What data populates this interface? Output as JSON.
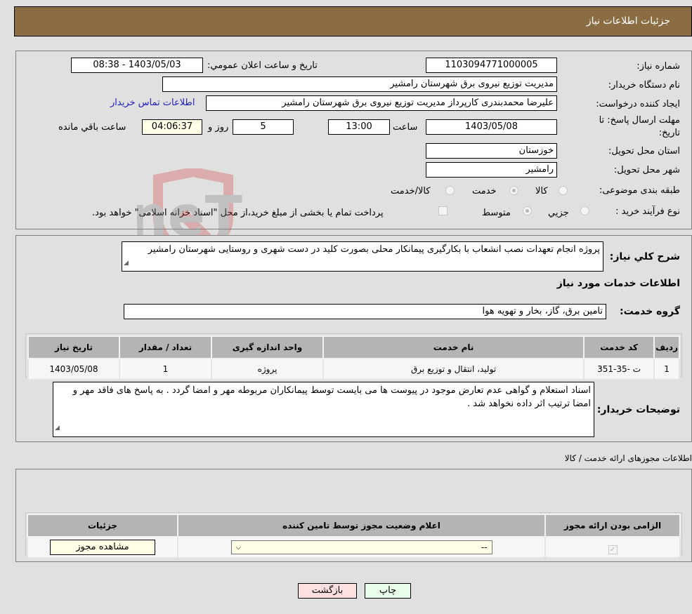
{
  "header": {
    "title": "جزئیات اطلاعات نیاز"
  },
  "details": {
    "need_number_label": "شماره نیاز:",
    "need_number": "1103094771000005",
    "announce_label": "تاریخ و ساعت اعلان عمومي:",
    "announce_value": "1403/05/03 - 08:38",
    "buyer_org_label": "نام دستگاه خریدار:",
    "buyer_org": "مدیریت توزیع نیروی برق شهرستان رامشیر",
    "creator_label": "ایجاد کننده درخواست:",
    "creator": "علیرضا محمدبندری کارپرداز مدیریت توزیع نیروی برق شهرستان رامشیر",
    "contact_link": "اطلاعات تماس خریدار",
    "deadline_label_1": "مهلت ارسال پاسخ: تا",
    "deadline_label_2": "تاریخ:",
    "deadline_date": "1403/05/08",
    "time_label": "ساعت",
    "deadline_time": "13:00",
    "days_value": "5",
    "days_label": "روز و",
    "remaining_time": "04:06:37",
    "remaining_label": "ساعت باقي مانده",
    "province_label": "استان محل تحویل:",
    "province": "خوزستان",
    "city_label": "شهر محل تحویل:",
    "city": "رامشیر",
    "category_label": "طبقه بندی موضوعی:",
    "category_options": [
      "کالا",
      "خدمت",
      "کالا/خدمت"
    ],
    "category_selected": "خدمت",
    "process_label": "نوع فرآیند خرید :",
    "process_options": [
      "جزيي",
      "متوسط"
    ],
    "process_selected": "متوسط",
    "treasury_note": "پرداخت تمام یا بخشی از مبلغ خرید،از محل \"اسناد خزانه اسلامی\" خواهد بود."
  },
  "description": {
    "label": "شرح کلي نیاز:",
    "text": "پروژه انجام تعهدات نصب انشعاب با بکارگیری پیمانکار محلی بصورت کلید در دست شهری و روستایی شهرستان رامشیر",
    "services_heading": "اطلاعات خدمات مورد نیاز",
    "service_group_label": "گروه خدمت:",
    "service_group": "تامین برق، گاز، بخار و تهویه هوا"
  },
  "services_table": {
    "headers": [
      "ردیف",
      "کد خدمت",
      "نام خدمت",
      "واحد اندازه گیری",
      "تعداد / مقدار",
      "تاریخ نیاز"
    ],
    "rows": [
      [
        "1",
        "ت -35-351",
        "تولید، انتقال و توزیع برق",
        "پروژه",
        "1",
        "1403/05/08"
      ]
    ]
  },
  "buyer_notes": {
    "label": "توضیحات خریدار:",
    "text": "اسناد استعلام و گواهی عدم تعارض موجود در پیوست ها می بایست توسط پیمانکاران مربوطه مهر و امضا گردد . به پاسخ های فاقد مهر و امضا ترتیب اثر داده نخواهد شد ."
  },
  "permits": {
    "heading": "اطلاعات مجوزهای ارائه خدمت / کالا",
    "headers": [
      "الزامی بودن ارائه مجوز",
      "اعلام وضعیت مجوز توسط تامین کننده",
      "جزئیات"
    ],
    "row": {
      "required_checked": true,
      "status_value": "--",
      "details_button": "مشاهده مجوز"
    }
  },
  "buttons": {
    "print": "چاپ",
    "back": "بازگشت"
  },
  "colors": {
    "header_bg": "#8b6d43",
    "back_button": "#ffe0e0",
    "print_button": "#eaffea",
    "link": "#2020c0"
  }
}
